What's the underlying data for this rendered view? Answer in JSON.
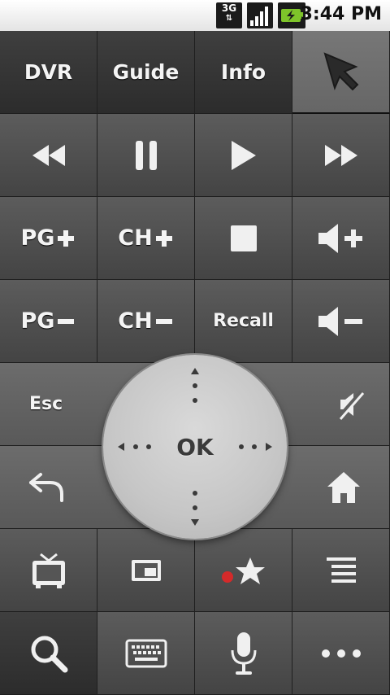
{
  "status_bar": {
    "network": "3G",
    "time": "3:44 PM"
  },
  "remote": {
    "dvr_label": "DVR",
    "guide_label": "Guide",
    "info_label": "Info",
    "pg_up_label": "PG",
    "ch_up_label": "CH",
    "pg_down_label": "PG",
    "ch_down_label": "CH",
    "recall_label": "Recall",
    "esc_label": "Esc",
    "ok_label": "OK"
  },
  "colors": {
    "record_dot": "#d42a2a",
    "icon": "#f0f0f0"
  },
  "icons": [
    "pointer-arrow-icon",
    "rewind-icon",
    "pause-icon",
    "play-icon",
    "fast-forward-icon",
    "stop-icon",
    "volume-up-icon",
    "volume-down-icon",
    "mute-icon",
    "back-icon",
    "home-icon",
    "tv-icon",
    "pip-icon",
    "record-favorite-icon",
    "menu-lines-icon",
    "search-icon",
    "keyboard-icon",
    "microphone-icon",
    "more-icon"
  ]
}
